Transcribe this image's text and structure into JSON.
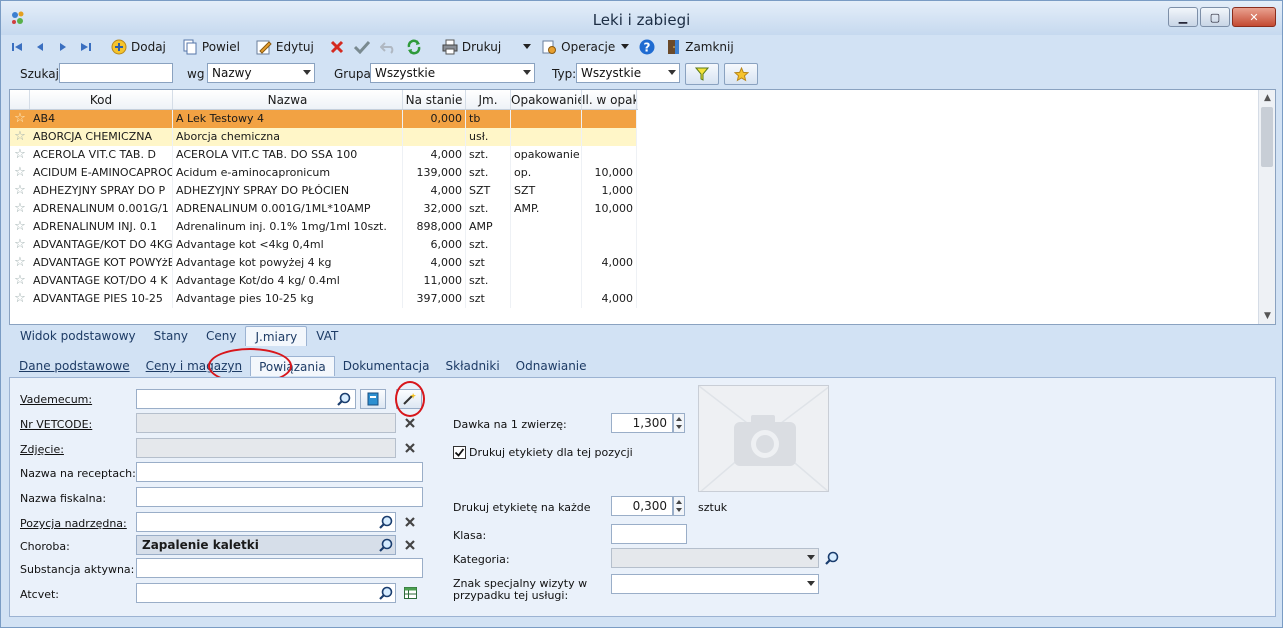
{
  "window": {
    "title": "Leki i zabiegi"
  },
  "toolbar": {
    "add": "Dodaj",
    "copy": "Powiel",
    "edit": "Edytuj",
    "print": "Drukuj",
    "operations": "Operacje",
    "close": "Zamknij"
  },
  "filters": {
    "search_label": "Szukaj:",
    "search_value": "",
    "by_label": "wg",
    "by_value": "Nazwy",
    "group_label": "Grupa:",
    "group_value": "Wszystkie",
    "type_label": "Typ:",
    "type_value": "Wszystkie"
  },
  "grid": {
    "columns": [
      "Kod",
      "Nazwa",
      "Na stanie",
      "Jm.",
      "Opakowanie",
      "Il. w opak."
    ],
    "rows": [
      {
        "kod": "AB4",
        "nazwa": "A Lek Testowy 4",
        "stan": "0,000",
        "jm": "tb",
        "opak": "",
        "il": ""
      },
      {
        "kod": "ABORCJA CHEMICZNA",
        "nazwa": "Aborcja chemiczna",
        "stan": "",
        "jm": "usł.",
        "opak": "",
        "il": ""
      },
      {
        "kod": "ACEROLA VIT.C TAB. D",
        "nazwa": "ACEROLA VIT.C TAB. DO SSA 100",
        "stan": "4,000",
        "jm": "szt.",
        "opak": "opakowanie",
        "il": ""
      },
      {
        "kod": "ACIDUM E-AMINOCAPROO",
        "nazwa": "Acidum e-aminocapronicum",
        "stan": "139,000",
        "jm": "szt.",
        "opak": "op.",
        "il": "10,000"
      },
      {
        "kod": "ADHEZYJNY SPRAY DO P",
        "nazwa": "ADHEZYJNY SPRAY DO PŁÓCIEN",
        "stan": "4,000",
        "jm": "SZT",
        "opak": "SZT",
        "il": "1,000"
      },
      {
        "kod": "ADRENALINUM 0.001G/1",
        "nazwa": "ADRENALINUM 0.001G/1ML*10AMP",
        "stan": "32,000",
        "jm": "szt.",
        "opak": "AMP.",
        "il": "10,000"
      },
      {
        "kod": "ADRENALINUM INJ. 0.1",
        "nazwa": "Adrenalinum inj. 0.1% 1mg/1ml 10szt.",
        "stan": "898,000",
        "jm": "AMP",
        "opak": "",
        "il": ""
      },
      {
        "kod": "ADVANTAGE/KOT DO 4KG",
        "nazwa": "Advantage kot <4kg 0,4ml",
        "stan": "6,000",
        "jm": "szt.",
        "opak": "",
        "il": ""
      },
      {
        "kod": "ADVANTAGE KOT POWYżE",
        "nazwa": "Advantage kot powyżej 4 kg",
        "stan": "4,000",
        "jm": "szt",
        "opak": "",
        "il": "4,000"
      },
      {
        "kod": "ADVANTAGE KOT/DO 4 K",
        "nazwa": "Advantage Kot/do 4 kg/ 0.4ml",
        "stan": "11,000",
        "jm": "szt.",
        "opak": "",
        "il": ""
      },
      {
        "kod": "ADVANTAGE PIES 10-25",
        "nazwa": "Advantage pies 10-25 kg",
        "stan": "397,000",
        "jm": "szt",
        "opak": "",
        "il": "4,000"
      }
    ]
  },
  "tabs_top": [
    "Widok podstawowy",
    "Stany",
    "Ceny",
    "J.miary",
    "VAT"
  ],
  "tabs_bottom": [
    "Dane podstawowe",
    "Ceny i magazyn",
    "Powiązania",
    "Dokumentacja",
    "Składniki",
    "Odnawianie"
  ],
  "form": {
    "vademecum_label": "Vademecum:",
    "vetcode_label": "Nr VETCODE:",
    "photo_label": "Zdjęcie:",
    "rx_name_label": "Nazwa na receptach:",
    "fiscal_name_label": "Nazwa fiskalna:",
    "parent_label": "Pozycja nadrzędna:",
    "disease_label": "Choroba:",
    "disease_value": "Zapalenie kaletki",
    "substance_label": "Substancja aktywna:",
    "atcvet_label": "Atcvet:",
    "dose_label": "Dawka na 1 zwierzę:",
    "dose_value": "1,300",
    "print_labels_label": "Drukuj etykiety dla tej pozycji",
    "print_label_every_label": "Drukuj etykietę na każde",
    "print_label_every_value": "0,300",
    "print_label_every_unit": "sztuk",
    "class_label": "Klasa:",
    "category_label": "Kategoria:",
    "special_sign_label_1": "Znak specjalny wizyty w",
    "special_sign_label_2": "przypadku tej usługi:"
  }
}
